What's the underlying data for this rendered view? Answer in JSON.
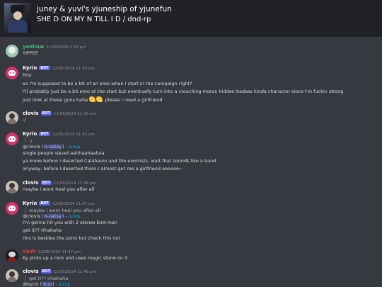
{
  "header": {
    "title": "juney & yuvi's yjuneship of yjunefun",
    "subtitle": "SHE D ON MY N TILL I D / dnd-rp"
  },
  "badge_label": "BOT",
  "messages": [
    {
      "author": "yeehaw",
      "timestamp": "11/09/2024 2:23 pm",
      "lines": [
        "YIPPEE"
      ]
    },
    {
      "author": "Kyrin",
      "timestamp": "12/05/2024 11:40 pm",
      "lines": [
        "first",
        "so I'm supposed to be a bit of an emo when I start in the campaign right?",
        "I'll probably just be a bit emo at the start but eventually turn into a crouching moron hidden badass kinda character since I'm fuckin strong",
        "just look at these guns haha",
        "please I need a girlfriend"
      ]
    },
    {
      "author": "clovis",
      "timestamp": "12/05/2024 11:43 pm",
      "lines": [
        ":/"
      ]
    },
    {
      "author": "Kyrin",
      "timestamp": "12/05/2024 11:43 pm",
      "reply": ":/",
      "lines": [
        "@clovis (",
        "o-oatsy",
        ") - ",
        "jump",
        "single people squad aahhaahaahaa",
        "ya know before I deserted Calahavin and the exorcists- wait that sounds like a band",
        "anyway- before I deserted them I almost got me a girlfriend oooooo~"
      ]
    },
    {
      "author": "clovis",
      "timestamp": "12/05/2024 11:46 pm",
      "lines": [
        "maybe i wont heal you after all"
      ]
    },
    {
      "author": "Kyrin",
      "timestamp": "12/05/2024 11:47 pm",
      "reply": "maybe i wont heal you after all",
      "lines": [
        "@clovis (",
        "o-oatsy",
        ") - ",
        "jump",
        "I'm gonna hit you with 2 stones bird-man",
        "get it?? Hhahaha",
        "this is besides the point but check this out"
      ]
    },
    {
      "author": "Vash",
      "timestamp": "12/05/2024 11:47 pm",
      "lines": [
        "Ky picks up a rock and uses magic stone on it"
      ]
    },
    {
      "author": "clovis",
      "timestamp": "12/05/2024 11:48 pm",
      "reply": "get it?? Hhahaha",
      "lines": [
        "@kyrin (",
        "Yuvi",
        ") - ",
        "jump"
      ]
    }
  ]
}
